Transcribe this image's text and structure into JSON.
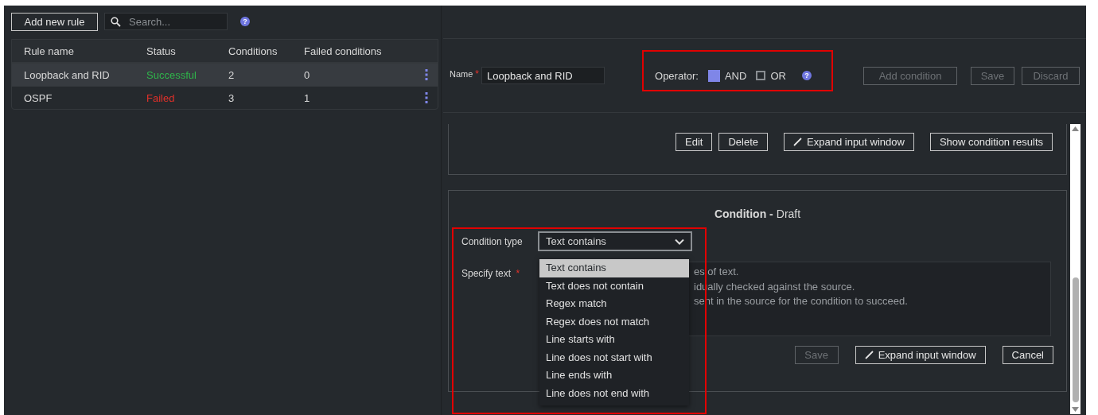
{
  "toolbar": {
    "add_button": "Add new rule",
    "search": {
      "placeholder": "Search..."
    },
    "help": "?"
  },
  "rules_table": {
    "columns": [
      "Rule name",
      "Status",
      "Conditions",
      "Failed conditions"
    ],
    "rows": [
      {
        "name": "Loopback and RID",
        "status": "Successful",
        "color": "#2fb44a",
        "conditions": "2",
        "failed": "0",
        "selected": true
      },
      {
        "name": "OSPF",
        "status": "Failed",
        "color": "#e0302a",
        "conditions": "3",
        "failed": "1",
        "selected": false
      }
    ]
  },
  "editor": {
    "name_field": {
      "label": "Name",
      "required_mark": "*",
      "value": "Loopback and RID"
    },
    "operator": {
      "label": "Operator:",
      "help": "?",
      "options": [
        {
          "label": "AND",
          "selected": true
        },
        {
          "label": "OR",
          "selected": false
        }
      ]
    },
    "buttons": [
      {
        "label": "Add condition",
        "disabled": true
      },
      {
        "label": "Save",
        "disabled": true
      },
      {
        "label": "Discard",
        "disabled": true
      }
    ]
  },
  "condition_card": {
    "buttons": [
      {
        "label": "Edit",
        "kind": "plain"
      },
      {
        "label": "Delete",
        "kind": "plain"
      },
      {
        "label": "Expand input window",
        "kind": "expand"
      },
      {
        "label": "Show condition results",
        "kind": "plain"
      }
    ]
  },
  "draft_card": {
    "title": "Condition -",
    "subtitle": "Draft",
    "type_field": {
      "label": "Condition type",
      "value": "Text contains",
      "expanded": true,
      "options": [
        {
          "label": "Text contains",
          "selected": true
        },
        {
          "label": "Text does not contain",
          "selected": false
        },
        {
          "label": "Regex match",
          "selected": false
        },
        {
          "label": "Regex does not match",
          "selected": false
        },
        {
          "label": "Line starts with",
          "selected": false
        },
        {
          "label": "Line does not start with",
          "selected": false
        },
        {
          "label": "Line ends with",
          "selected": false
        },
        {
          "label": "Line does not end with",
          "selected": false
        }
      ]
    },
    "text_field": {
      "label": "Specify text",
      "required_mark": "*",
      "placeholder_lines": [
        "es of text.",
        "idually checked against the source.",
        "sent in the source for the condition to succeed."
      ]
    },
    "buttons": [
      {
        "label": "Save",
        "kind": "plain",
        "disabled": true
      },
      {
        "label": "Expand input window",
        "kind": "expand",
        "disabled": false
      },
      {
        "label": "Cancel",
        "kind": "plain",
        "disabled": false
      }
    ]
  }
}
